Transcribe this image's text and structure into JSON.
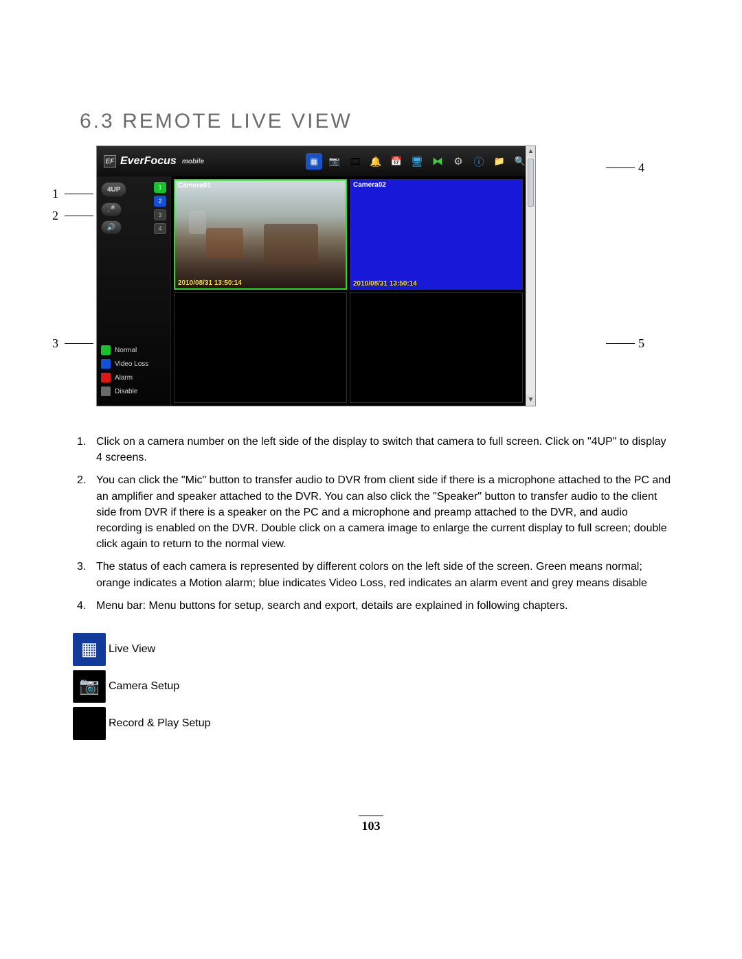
{
  "section": {
    "number": "6.3",
    "title": "REMOTE LIVE VIEW"
  },
  "callouts": {
    "c1": "1",
    "c2": "2",
    "c3": "3",
    "c4": "4",
    "c5": "5"
  },
  "app": {
    "brand": "EverFocus",
    "brand_sup": "mobile",
    "toolbar": {
      "live": "live-view-icon",
      "camera": "camera-setup-icon",
      "record": "record-play-icon",
      "alarm": "alarm-icon",
      "schedule": "schedule-icon",
      "monitor": "monitor-icon",
      "network": "network-icon",
      "settings": "settings-icon",
      "info": "info-icon",
      "export": "export-icon",
      "search": "search-icon"
    },
    "sidebar": {
      "fourup": "4UP",
      "channels": [
        "1",
        "2",
        "3",
        "4"
      ],
      "legend": [
        {
          "label": "Normal",
          "color": "g"
        },
        {
          "label": "Video Loss",
          "color": "b"
        },
        {
          "label": "Alarm",
          "color": "r"
        },
        {
          "label": "Disable",
          "color": "gr"
        }
      ]
    },
    "cameras": [
      {
        "name": "Camera01",
        "ts": "2010/08/31 13:50:14",
        "active": true,
        "kind": "live"
      },
      {
        "name": "Camera02",
        "ts": "2010/08/31 13:50:14",
        "active": false,
        "kind": "videoloss"
      },
      {
        "name": "",
        "ts": "",
        "active": false,
        "kind": "empty"
      },
      {
        "name": "",
        "ts": "",
        "active": false,
        "kind": "empty"
      }
    ]
  },
  "body": {
    "i1": "Click on a camera number on the left side of the display to switch that camera to full screen. Click on \"4UP\" to display 4 screens.",
    "i2": "You can click the \"Mic\" button to transfer audio to DVR from client side if there is a microphone attached to the PC and an amplifier and speaker attached to the DVR. You can also click the \"Speaker\" button to transfer audio to the client side from DVR if there is a speaker on the PC and a microphone and preamp attached to the DVR, and audio recording is enabled on the DVR. Double click on a camera image to enlarge the current display to full screen; double click again to return to the normal view.",
    "i3": "The status of each camera is represented by different colors on the left side of the screen. Green means normal; orange indicates a Motion alarm; blue indicates Video Loss, red indicates an alarm event and grey means disable",
    "i4_prefix": "Menu bar: ",
    "i4": "Menu buttons for setup, search and export, details are explained in following chapters."
  },
  "icon_defs": [
    {
      "label": "Live View",
      "icon": "grid"
    },
    {
      "label": "Camera Setup",
      "icon": "cam"
    },
    {
      "label": "Record & Play Setup",
      "icon": "rec"
    }
  ],
  "page_number": "103"
}
